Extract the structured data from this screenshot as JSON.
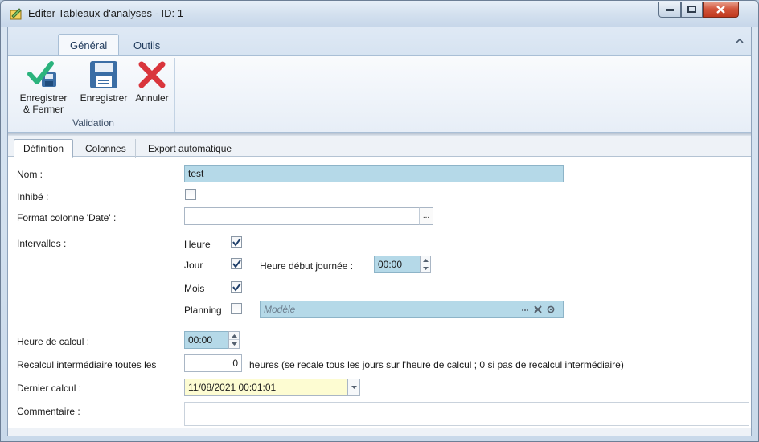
{
  "window": {
    "title": "Editer Tableaux d'analyses - ID: 1"
  },
  "ribbon": {
    "tabs": [
      {
        "label": "Général"
      },
      {
        "label": "Outils"
      }
    ],
    "group_label": "Validation",
    "buttons": [
      {
        "label_line1": "Enregistrer",
        "label_line2": "& Fermer",
        "icon": "save-close-check-icon"
      },
      {
        "label_line1": "Enregistrer",
        "label_line2": "",
        "icon": "floppy-disk-icon"
      },
      {
        "label_line1": "Annuler",
        "label_line2": "",
        "icon": "red-x-icon"
      }
    ]
  },
  "tabs": [
    {
      "label": "Définition"
    },
    {
      "label": "Colonnes"
    },
    {
      "label": "Export automatique"
    }
  ],
  "form": {
    "nom_label": "Nom :",
    "nom_value": "test",
    "inhibe_label": "Inhibé :",
    "inhibe_checked": false,
    "format_label": "Format colonne 'Date' :",
    "format_value": "",
    "ellipsis": "...",
    "intervalles_label": "Intervalles :",
    "heure_label": "Heure",
    "heure_checked": true,
    "jour_label": "Jour",
    "jour_checked": true,
    "heure_debut_label": "Heure début journée :",
    "heure_debut_value": "00:00",
    "mois_label": "Mois",
    "mois_checked": true,
    "planning_label": "Planning",
    "planning_checked": false,
    "modele_placeholder": "Modèle",
    "heure_calcul_label": "Heure de calcul :",
    "heure_calcul_value": "00:00",
    "recalcul_label": "Recalcul intermédiaire toutes les",
    "recalcul_value": "0",
    "recalcul_hint": "heures (se recale tous les jours sur l'heure de calcul ; 0 si pas de recalcul intermédiaire)",
    "dernier_calcul_label": "Dernier calcul :",
    "dernier_calcul_value": "11/08/2021  00:01:01",
    "commentaire_label": "Commentaire :",
    "commentaire_value": ""
  },
  "colors": {
    "highlight_input": "#b5d9e8",
    "date_input": "#fdfcd2",
    "cancel_red": "#d9353c",
    "save_blue": "#3b6ea5",
    "check_green": "#2bb37d"
  }
}
